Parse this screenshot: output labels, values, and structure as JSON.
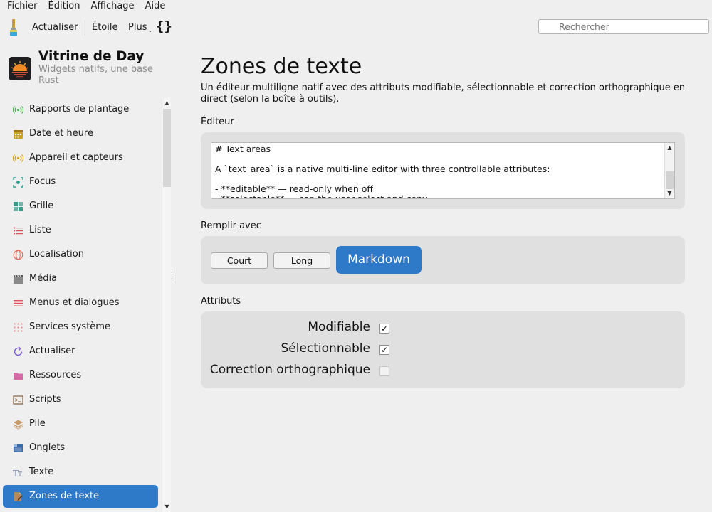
{
  "menu": [
    "Fichier",
    "Édition",
    "Affichage",
    "Aide"
  ],
  "toolbar": {
    "refresh_label": "Actualiser",
    "star_label": "Étoile",
    "more_label": "Plus",
    "braces_label": "{}",
    "search_placeholder": "Rechercher"
  },
  "app": {
    "title": "Vitrine de Day",
    "subtitle": "Widgets natifs, une base Rust"
  },
  "sidebar": {
    "items": [
      {
        "label": "Rapports de plantage",
        "icon": "broadcast-icon",
        "color": "#4caf50"
      },
      {
        "label": "Date et heure",
        "icon": "calendar-icon",
        "color": "#c9a227"
      },
      {
        "label": "Appareil et capteurs",
        "icon": "sensor-icon",
        "color": "#d4a017"
      },
      {
        "label": "Focus",
        "icon": "focus-icon",
        "color": "#2e9e8f"
      },
      {
        "label": "Grille",
        "icon": "grid-icon",
        "color": "#3a9a8a"
      },
      {
        "label": "Liste",
        "icon": "list-icon",
        "color": "#e0505a"
      },
      {
        "label": "Localisation",
        "icon": "globe-icon",
        "color": "#e86a5a"
      },
      {
        "label": "Média",
        "icon": "clapper-icon",
        "color": "#888888"
      },
      {
        "label": "Menus et dialogues",
        "icon": "menu-icon",
        "color": "#e0505a"
      },
      {
        "label": "Services système",
        "icon": "dots-icon",
        "color": "#e88a8a"
      },
      {
        "label": "Actualiser",
        "icon": "refresh-icon",
        "color": "#7a5ad0"
      },
      {
        "label": "Ressources",
        "icon": "folder-icon",
        "color": "#d96aa8"
      },
      {
        "label": "Scripts",
        "icon": "terminal-icon",
        "color": "#8a6a4a"
      },
      {
        "label": "Pile",
        "icon": "stack-icon",
        "color": "#c59a6a"
      },
      {
        "label": "Onglets",
        "icon": "tabs-icon",
        "color": "#3a6aa8"
      },
      {
        "label": "Texte",
        "icon": "text-icon",
        "color": "#7a8ab8"
      },
      {
        "label": "Zones de texte",
        "icon": "document-edit-icon",
        "color": "#b08a5a",
        "selected": true
      }
    ]
  },
  "main": {
    "title": "Zones de texte",
    "description": "Un éditeur multiligne natif avec des attributs modifiable, sélectionnable et correction orthographique en direct (selon la boîte à outils).",
    "editor_label": "Éditeur",
    "editor_text": "# Text areas\n\nA `text_area` is a native multi-line editor with three controllable attributes:\n\n- **editable** — read-only when off\n- **selectable** — can the user select and copy",
    "fill_label": "Remplir avec",
    "fill_buttons": {
      "short": "Court",
      "long": "Long",
      "markdown": "Markdown"
    },
    "attributes_label": "Attributs",
    "attributes": [
      {
        "label": "Modifiable",
        "checked": true,
        "mark": "✓"
      },
      {
        "label": "Sélectionnable",
        "checked": true,
        "mark": "✓"
      },
      {
        "label": "Correction orthographique",
        "checked": false,
        "mark": ""
      }
    ]
  },
  "colors": {
    "accent": "#2f79c9",
    "background": "#efefef",
    "card": "#e0e0e0"
  }
}
